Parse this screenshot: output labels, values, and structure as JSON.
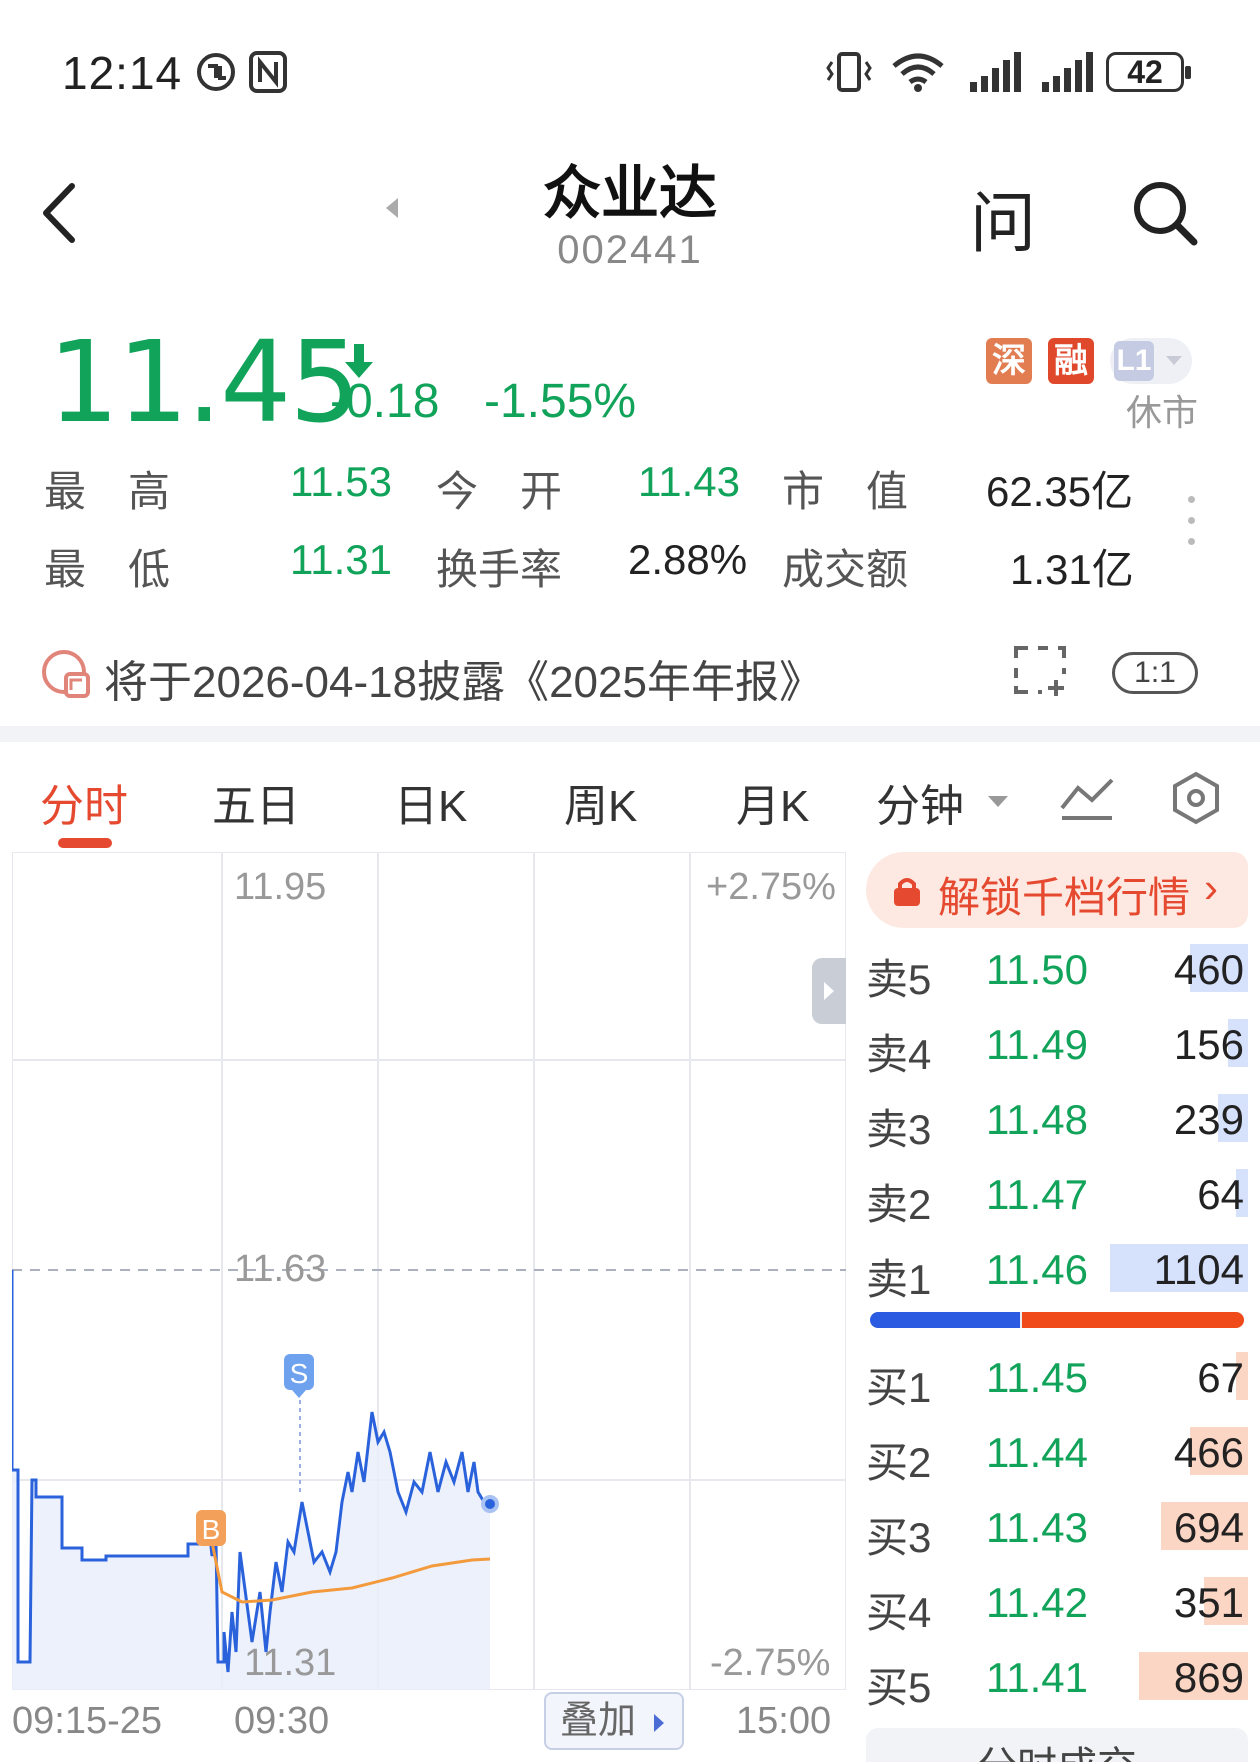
{
  "status_bar": {
    "time": "12:14",
    "battery": "42"
  },
  "header": {
    "title": "众业达",
    "code": "002441",
    "ask_label": "问"
  },
  "quote": {
    "price": "11.45",
    "change": "-0.18",
    "change_pct": "-1.55%",
    "badges": [
      "深",
      "融",
      "L1"
    ],
    "market_status": "休市",
    "stats": [
      {
        "label": "最　高",
        "value": "11.53"
      },
      {
        "label": "今　开",
        "value": "11.43"
      },
      {
        "label": "市　值",
        "value": "62.35亿"
      },
      {
        "label": "最　低",
        "value": "11.31"
      },
      {
        "label": "换手率",
        "value": "2.88%"
      },
      {
        "label": "成交额",
        "value": "1.31亿"
      }
    ]
  },
  "notice": {
    "text": "将于2026-04-18披露《2025年年报》",
    "ratio_label": "1:1"
  },
  "tabs": [
    "分时",
    "五日",
    "日K",
    "周K",
    "月K",
    "分钟"
  ],
  "chart": {
    "overlay_label": "叠加",
    "price_axis": {
      "top": "11.95",
      "mid": "11.63",
      "bottom": "11.31"
    },
    "pct_axis": {
      "top": "+2.75%",
      "bottom": "-2.75%"
    },
    "time_labels": [
      "09:15-25",
      "09:30",
      "15:00"
    ],
    "markers": {
      "buy": "B",
      "sell": "S"
    }
  },
  "order_book": {
    "unlock_label": "解锁千档行情",
    "asks": [
      {
        "name": "卖5",
        "price": "11.50",
        "volume": "460"
      },
      {
        "name": "卖4",
        "price": "11.49",
        "volume": "156"
      },
      {
        "name": "卖3",
        "price": "11.48",
        "volume": "239"
      },
      {
        "name": "卖2",
        "price": "11.47",
        "volume": "64"
      },
      {
        "name": "卖1",
        "price": "11.46",
        "volume": "1104"
      }
    ],
    "bids": [
      {
        "name": "买1",
        "price": "11.45",
        "volume": "67"
      },
      {
        "name": "买2",
        "price": "11.44",
        "volume": "466"
      },
      {
        "name": "买3",
        "price": "11.43",
        "volume": "694"
      },
      {
        "name": "买4",
        "price": "11.42",
        "volume": "351"
      },
      {
        "name": "买5",
        "price": "11.41",
        "volume": "869"
      }
    ],
    "buy_ratio": 0.4,
    "tick_panel_label": "分时成交"
  },
  "colors": {
    "up": "#e5492f",
    "down": "#11a35a",
    "line": "#2a62dc",
    "avg": "#f29a3c"
  }
}
